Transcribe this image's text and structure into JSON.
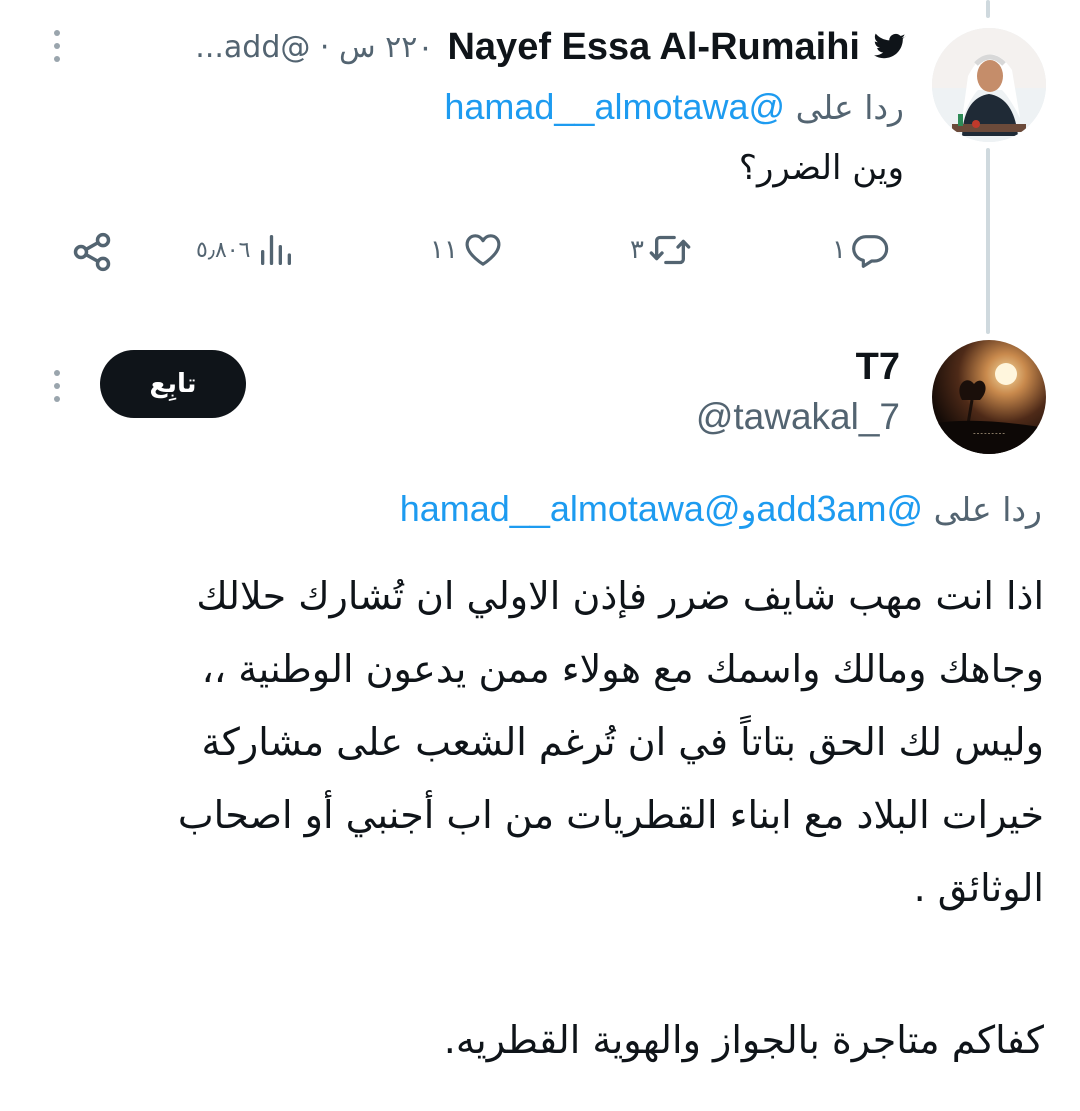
{
  "tweet1": {
    "display_name": "Nayef Essa Al-Rumaihi",
    "meta_text": "۲۲۰ س · @add...",
    "reply_prefix": "ردا على",
    "reply_handle": "@hamad__almotawa",
    "body": "وين الضرر؟",
    "actions": {
      "replies": "١",
      "retweets": "٣",
      "likes": "١١",
      "views": "٥٫٨٠٦"
    }
  },
  "tweet2": {
    "display_name": "T7",
    "handle": "@tawakal_7",
    "follow_label": "تابِع",
    "reply_prefix": "ردا على",
    "reply_handle_1": "@add3am",
    "reply_joiner": "و",
    "reply_handle_2": "@hamad__almotawa",
    "body_lines": [
      "اذا انت مهب شايف ضرر فإذن الاولي ان تُشارك حلالك",
      "وجاهك ومالك واسمك مع هولاء ممن يدعون الوطنية ،،",
      "وليس لك الحق بتاتاً في ان تُرغم الشعب على مشاركة",
      "خيرات البلاد مع ابناء القطريات من اب أجنبي أو اصحاب",
      "الوثائق ."
    ],
    "body_last": "كفاكم متاجرة بالجواز والهوية القطريه."
  },
  "icons": {
    "verified": "twitter-bird-icon",
    "more": "more-vertical-icon",
    "reply": "reply-bubble-icon",
    "retweet": "retweet-icon",
    "like": "heart-icon",
    "views": "views-chart-icon",
    "share": "share-icon"
  },
  "colors": {
    "link": "#1d9bf0",
    "text": "#0f1419",
    "secondary": "#536471",
    "thread_line": "#cfd9de",
    "button_bg": "#0f1419"
  }
}
